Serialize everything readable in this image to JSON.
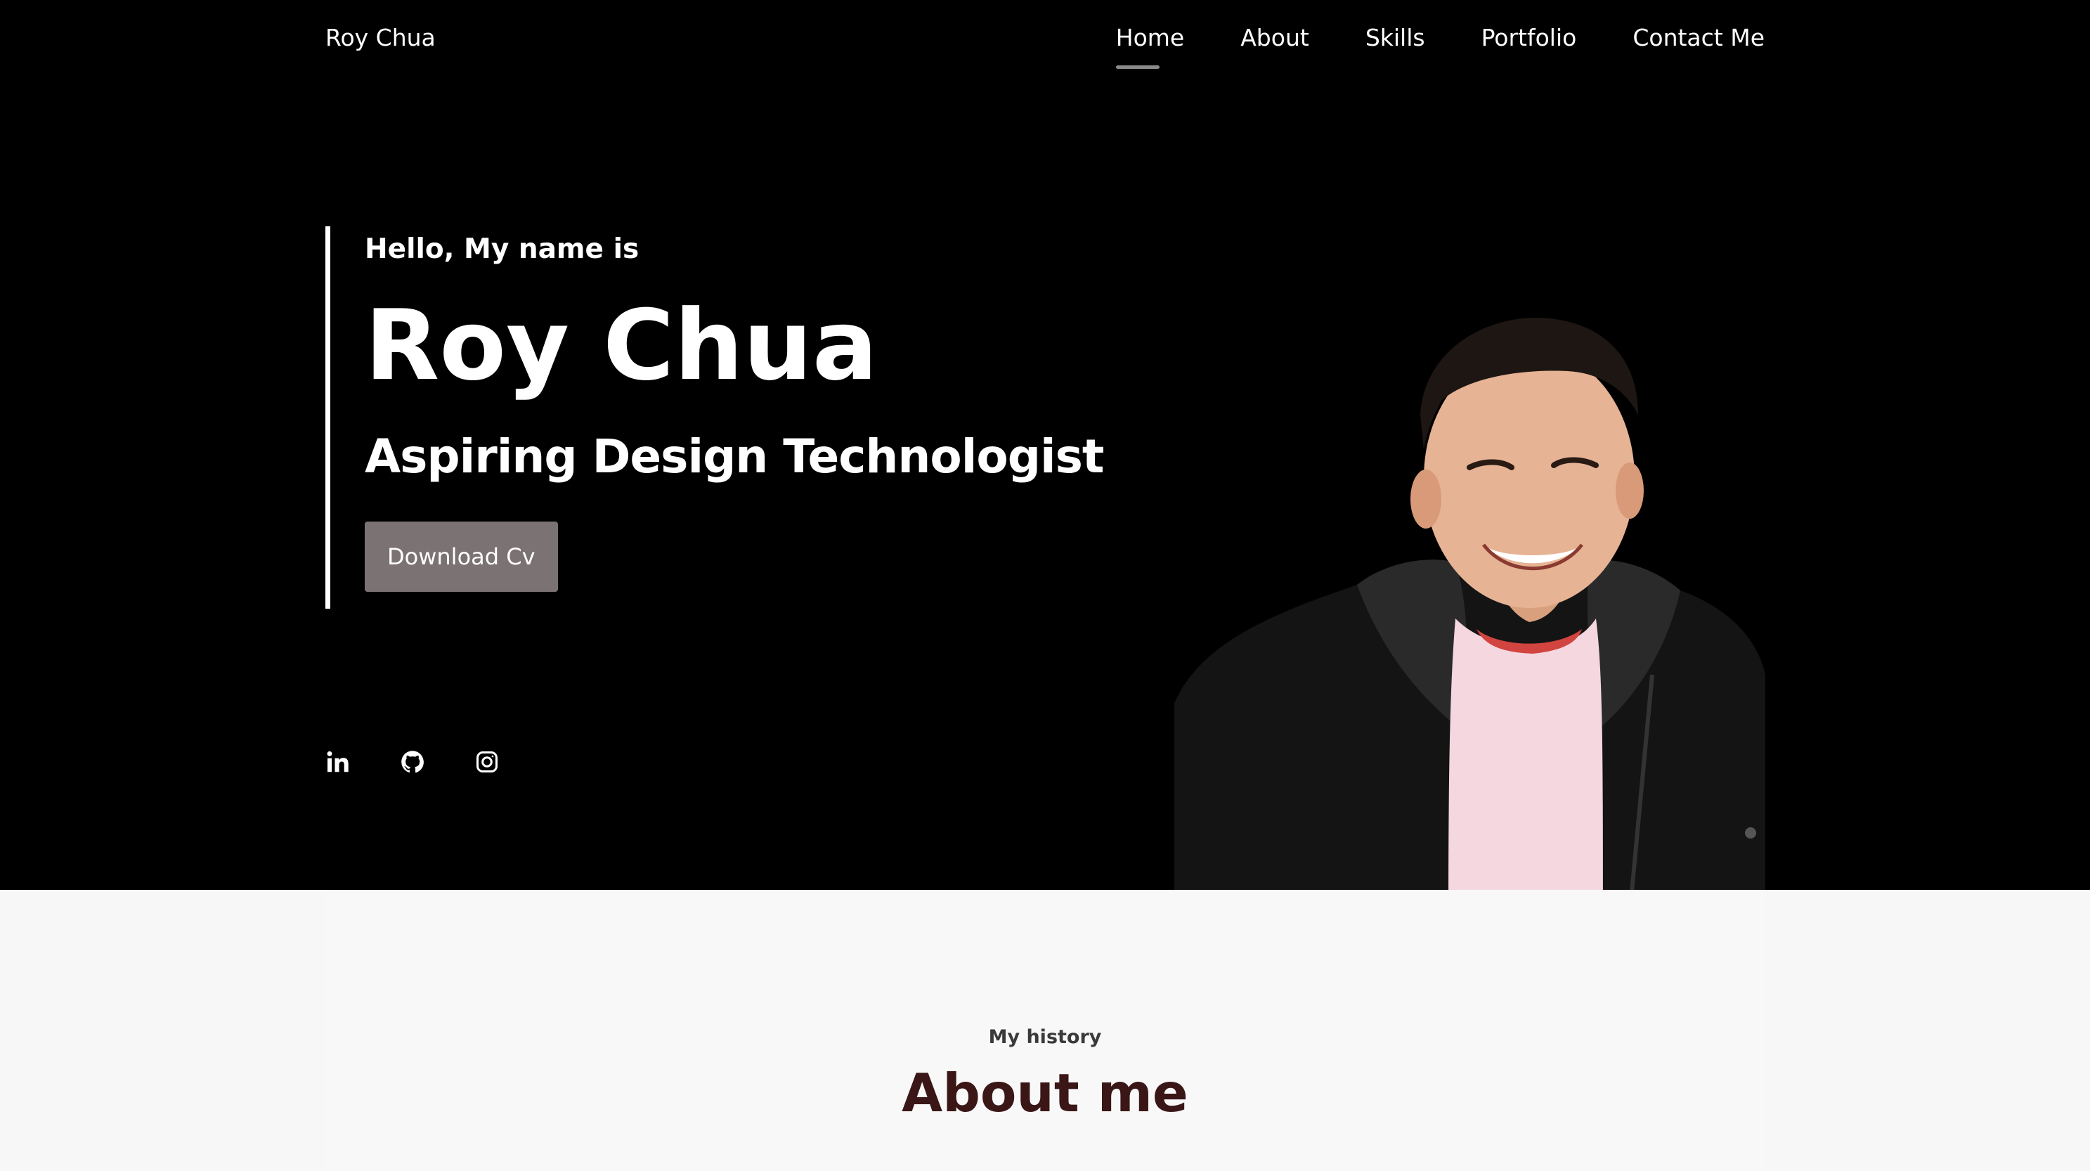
{
  "header": {
    "brand": "Roy Chua",
    "nav": [
      {
        "label": "Home",
        "active": true
      },
      {
        "label": "About",
        "active": false
      },
      {
        "label": "Skills",
        "active": false
      },
      {
        "label": "Portfolio",
        "active": false
      },
      {
        "label": "Contact Me",
        "active": false
      }
    ]
  },
  "hero": {
    "greeting": "Hello, My name is",
    "name": "Roy Chua",
    "role": "Aspiring Design Technologist",
    "cv_button": "Download Cv",
    "socials": [
      {
        "icon": "linkedin-icon"
      },
      {
        "icon": "github-icon"
      },
      {
        "icon": "instagram-icon"
      }
    ]
  },
  "about": {
    "eyebrow": "My history",
    "title": "About me"
  },
  "colors": {
    "hero_bg": "#000000",
    "button_bg": "#7b7274",
    "nav_underline": "#8a8a8a",
    "section_bg": "#f8f7f7",
    "section_title": "#3a1616"
  }
}
